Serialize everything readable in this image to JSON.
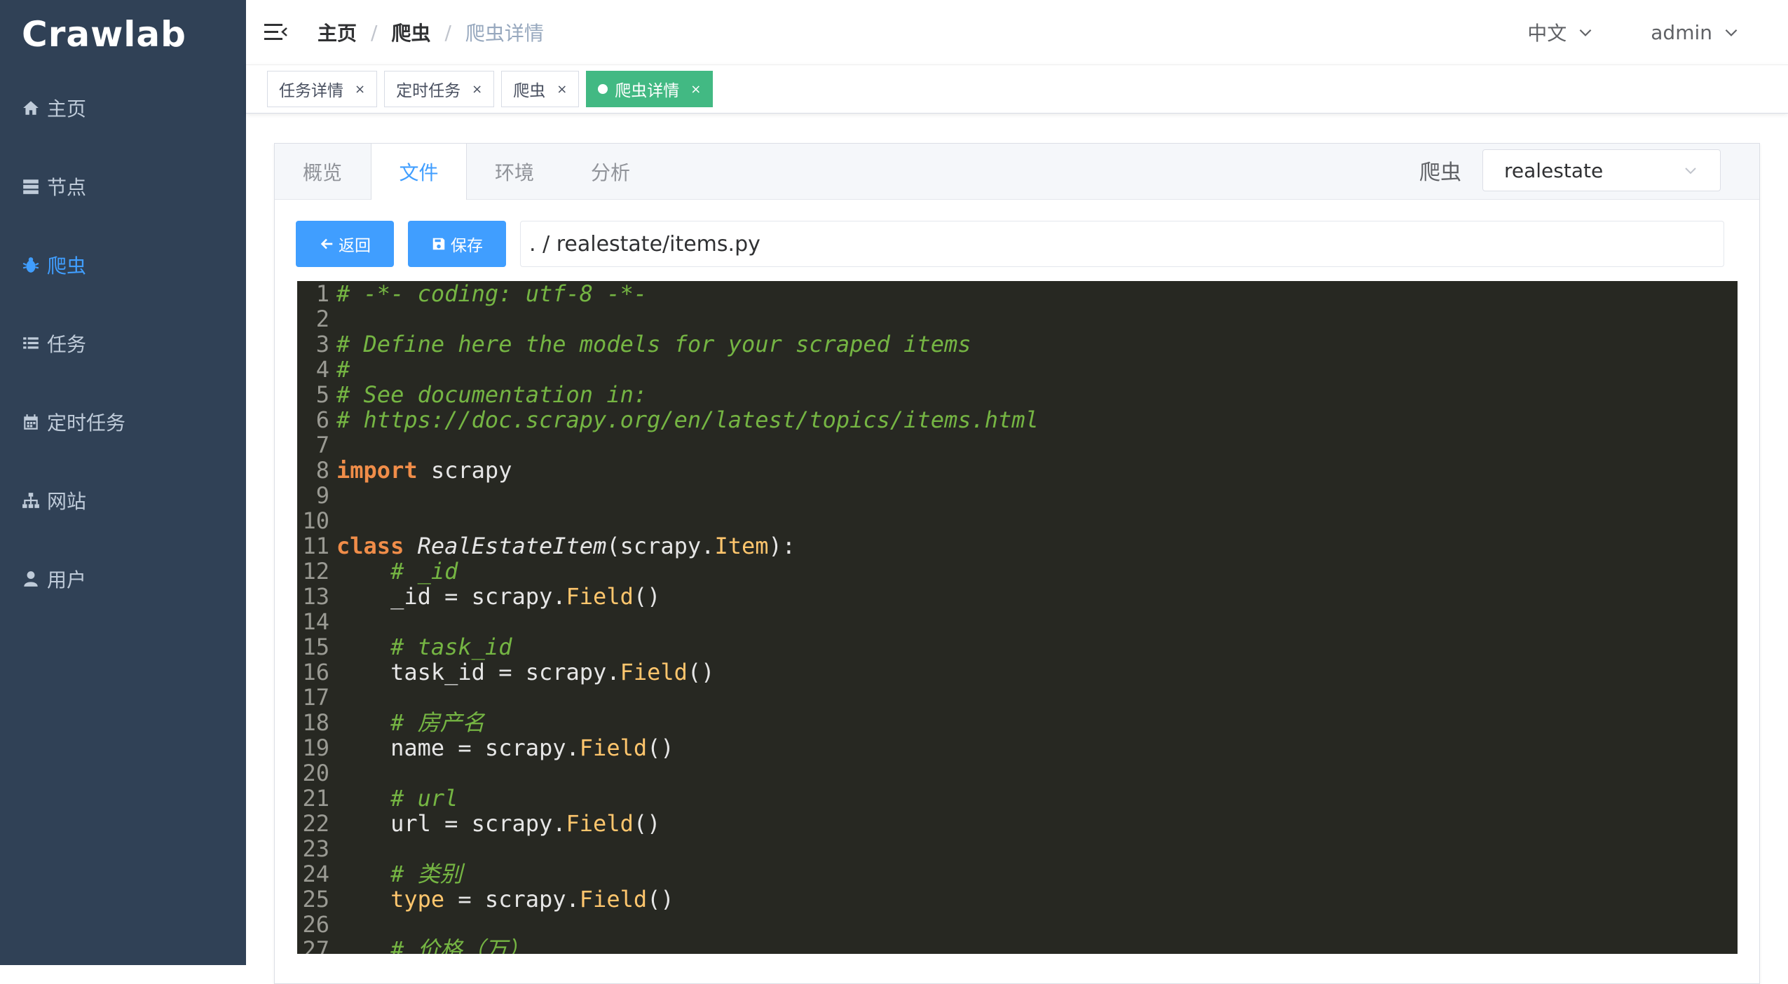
{
  "app": {
    "logo": "Crawlab"
  },
  "sidebar": {
    "items": [
      {
        "label": "主页",
        "icon": "home-icon",
        "active": false
      },
      {
        "label": "节点",
        "icon": "server-icon",
        "active": false
      },
      {
        "label": "爬虫",
        "icon": "bug-icon",
        "active": true
      },
      {
        "label": "任务",
        "icon": "list-icon",
        "active": false
      },
      {
        "label": "定时任务",
        "icon": "calendar-icon",
        "active": false
      },
      {
        "label": "网站",
        "icon": "sitemap-icon",
        "active": false
      },
      {
        "label": "用户",
        "icon": "user-icon",
        "active": false
      }
    ]
  },
  "header": {
    "breadcrumb": [
      "主页",
      "爬虫",
      "爬虫详情"
    ],
    "language": "中文",
    "user": "admin"
  },
  "tags": [
    {
      "label": "任务详情",
      "active": false
    },
    {
      "label": "定时任务",
      "active": false
    },
    {
      "label": "爬虫",
      "active": false
    },
    {
      "label": "爬虫详情",
      "active": true
    }
  ],
  "tabs": [
    {
      "label": "概览",
      "active": false
    },
    {
      "label": "文件",
      "active": true
    },
    {
      "label": "环境",
      "active": false
    },
    {
      "label": "分析",
      "active": false
    }
  ],
  "spider_select": {
    "label": "爬虫",
    "value": "realestate"
  },
  "toolbar": {
    "back_label": "返回",
    "save_label": "保存"
  },
  "file_path": ". / realestate/items.py",
  "editor": {
    "colors": {
      "background": "#272822",
      "comment": "#75b543",
      "keyword": "#f08d49",
      "field": "#ffc66d"
    },
    "lines": [
      [
        {
          "t": "cm",
          "v": "# -*- coding: utf-8 -*-"
        }
      ],
      [],
      [
        {
          "t": "cm",
          "v": "# Define here the models for your scraped items"
        }
      ],
      [
        {
          "t": "cm",
          "v": "#"
        }
      ],
      [
        {
          "t": "cm",
          "v": "# See documentation in:"
        }
      ],
      [
        {
          "t": "cm",
          "v": "# https://doc.scrapy.org/en/latest/topics/items.html"
        }
      ],
      [],
      [
        {
          "t": "kw",
          "v": "import"
        },
        {
          "t": "code",
          "v": " scrapy"
        }
      ],
      [],
      [],
      [
        {
          "t": "kw",
          "v": "class"
        },
        {
          "t": "code",
          "v": " "
        },
        {
          "t": "cls",
          "v": "RealEstateItem"
        },
        {
          "t": "code",
          "v": "(scrapy."
        },
        {
          "t": "fn",
          "v": "Item"
        },
        {
          "t": "code",
          "v": "):"
        }
      ],
      [
        {
          "t": "code",
          "v": "    "
        },
        {
          "t": "cm",
          "v": "# _id"
        }
      ],
      [
        {
          "t": "code",
          "v": "    _id = scrapy."
        },
        {
          "t": "fn",
          "v": "Field"
        },
        {
          "t": "code",
          "v": "()"
        }
      ],
      [],
      [
        {
          "t": "code",
          "v": "    "
        },
        {
          "t": "cm",
          "v": "# task_id"
        }
      ],
      [
        {
          "t": "code",
          "v": "    task_id = scrapy."
        },
        {
          "t": "fn",
          "v": "Field"
        },
        {
          "t": "code",
          "v": "()"
        }
      ],
      [],
      [
        {
          "t": "code",
          "v": "    "
        },
        {
          "t": "cm",
          "v": "# 房产名"
        }
      ],
      [
        {
          "t": "code",
          "v": "    name = scrapy."
        },
        {
          "t": "fn",
          "v": "Field"
        },
        {
          "t": "code",
          "v": "()"
        }
      ],
      [],
      [
        {
          "t": "code",
          "v": "    "
        },
        {
          "t": "cm",
          "v": "# url"
        }
      ],
      [
        {
          "t": "code",
          "v": "    url = scrapy."
        },
        {
          "t": "fn",
          "v": "Field"
        },
        {
          "t": "code",
          "v": "()"
        }
      ],
      [],
      [
        {
          "t": "code",
          "v": "    "
        },
        {
          "t": "cm",
          "v": "# 类别"
        }
      ],
      [
        {
          "t": "code",
          "v": "    "
        },
        {
          "t": "fn",
          "v": "type"
        },
        {
          "t": "code",
          "v": " = scrapy."
        },
        {
          "t": "fn",
          "v": "Field"
        },
        {
          "t": "code",
          "v": "()"
        }
      ],
      [],
      [
        {
          "t": "code",
          "v": "    "
        },
        {
          "t": "cm",
          "v": "# 价格（万）"
        }
      ]
    ]
  }
}
